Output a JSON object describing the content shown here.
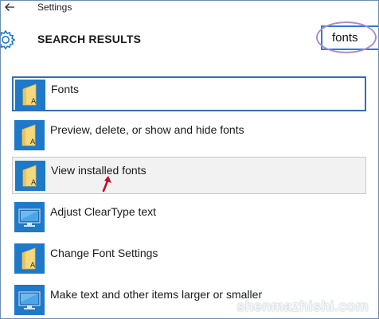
{
  "window": {
    "title": "Settings"
  },
  "header": {
    "heading": "SEARCH RESULTS",
    "search_value": "fonts"
  },
  "results": [
    {
      "label": "Fonts",
      "icon": "folder-icon",
      "state": "selected"
    },
    {
      "label": "Preview, delete, or show and hide fonts",
      "icon": "folder-icon",
      "state": "normal"
    },
    {
      "label": "View installed fonts",
      "icon": "folder-icon",
      "state": "hovered"
    },
    {
      "label": "Adjust ClearType text",
      "icon": "monitor-icon",
      "state": "normal"
    },
    {
      "label": "Change Font Settings",
      "icon": "folder-icon",
      "state": "normal"
    },
    {
      "label": "Make text and other items larger or smaller",
      "icon": "monitor-icon",
      "state": "normal"
    }
  ],
  "watermark": "shenmazhishi.com",
  "colors": {
    "accent": "#1e79c9",
    "selection_border": "#2f6fb5",
    "search_border": "#2b7ad9",
    "annotation_oval": "#a98bd0",
    "annotation_arrow": "#c0102a"
  }
}
